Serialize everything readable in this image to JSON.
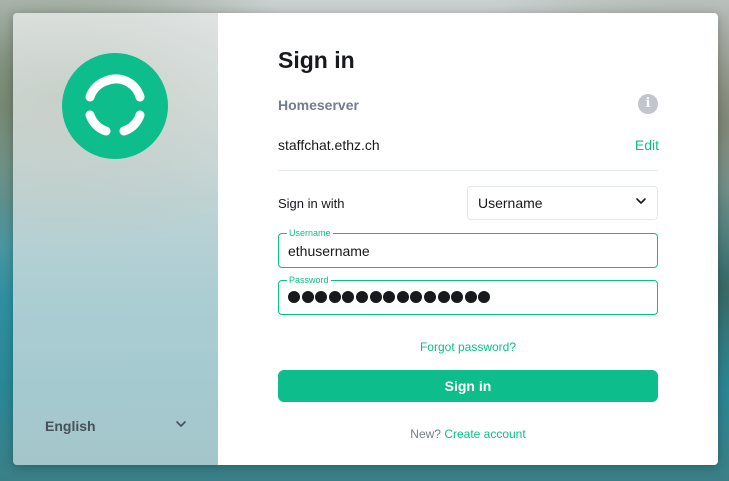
{
  "sidebar": {
    "logo_icon": "element-logo-icon",
    "language": {
      "label": "English",
      "icon": "chevron-down-icon"
    }
  },
  "form": {
    "title": "Sign in",
    "homeserver": {
      "label": "Homeserver",
      "info_icon": "info-icon",
      "value": "staffchat.ethz.ch",
      "edit_label": "Edit"
    },
    "sign_in_with": {
      "label": "Sign in with",
      "selected": "Username",
      "icon": "chevron-down-icon"
    },
    "username": {
      "label": "Username",
      "value": "ethusername"
    },
    "password": {
      "label": "Password",
      "masked_length": 15
    },
    "forgot_label": "Forgot password?",
    "submit_label": "Sign in",
    "create": {
      "prefix": "New?",
      "link_label": "Create account"
    }
  },
  "colors": {
    "accent": "#0dbd8b",
    "text_primary": "#17191c",
    "text_secondary": "#737d8c",
    "border": "#e3e8f0"
  }
}
